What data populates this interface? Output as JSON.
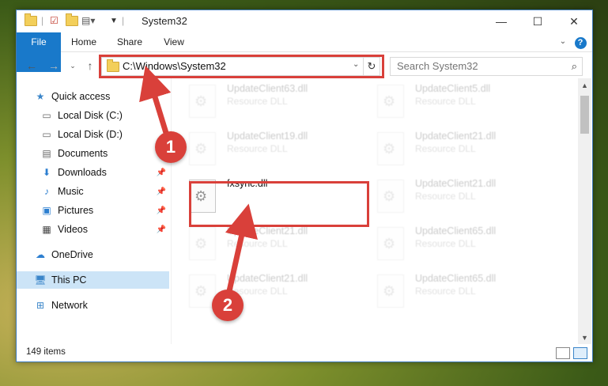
{
  "window": {
    "title": "System32",
    "controls": {
      "minimize": "—",
      "maximize": "☐",
      "close": "✕"
    }
  },
  "ribbon": {
    "tabs": [
      "File",
      "Home",
      "Share",
      "View"
    ],
    "help": "?"
  },
  "navigation": {
    "address": "C:\\Windows\\System32",
    "search_placeholder": "Search System32"
  },
  "sidebar": {
    "items": [
      {
        "label": "Quick access",
        "icon": "star-icon"
      },
      {
        "label": "Local Disk (C:)",
        "icon": "drive-icon"
      },
      {
        "label": "Local Disk (D:)",
        "icon": "drive-icon"
      },
      {
        "label": "Documents",
        "icon": "documents-icon",
        "pinned": true
      },
      {
        "label": "Downloads",
        "icon": "download-icon",
        "pinned": true
      },
      {
        "label": "Music",
        "icon": "music-icon",
        "pinned": true
      },
      {
        "label": "Pictures",
        "icon": "pictures-icon",
        "pinned": true
      },
      {
        "label": "Videos",
        "icon": "videos-icon",
        "pinned": true
      },
      {
        "label": "OneDrive",
        "icon": "cloud-icon"
      },
      {
        "label": "This PC",
        "icon": "computer-icon",
        "selected": true
      },
      {
        "label": "Network",
        "icon": "network-icon"
      }
    ]
  },
  "files": {
    "items": [
      {
        "name": "UpdateClient63.dll",
        "type": "Resource DLL"
      },
      {
        "name": "UpdateClient5.dll",
        "type": "Resource DLL"
      },
      {
        "name": "UpdateClient19.dll",
        "type": "Resource DLL"
      },
      {
        "name": "UpdateClient21.dll",
        "type": "Resource DLL"
      },
      {
        "name": "fxsync.dll",
        "type": ""
      },
      {
        "name": "UpdateClient21.dll",
        "type": "Resource DLL"
      },
      {
        "name": "UpdateClient21.dll",
        "type": "Resource DLL"
      },
      {
        "name": "UpdateClient65.dll",
        "type": "Resource DLL"
      },
      {
        "name": "UpdateClient21.dll",
        "type": "Resource DLL"
      },
      {
        "name": "UpdateClient65.dll",
        "type": "Resource DLL"
      }
    ]
  },
  "status": {
    "item_count": "149 items"
  },
  "annotations": {
    "step1": "1",
    "step2": "2"
  },
  "colors": {
    "accent": "#1979ca",
    "highlight": "#d9403a",
    "selected": "#cce4f7"
  }
}
